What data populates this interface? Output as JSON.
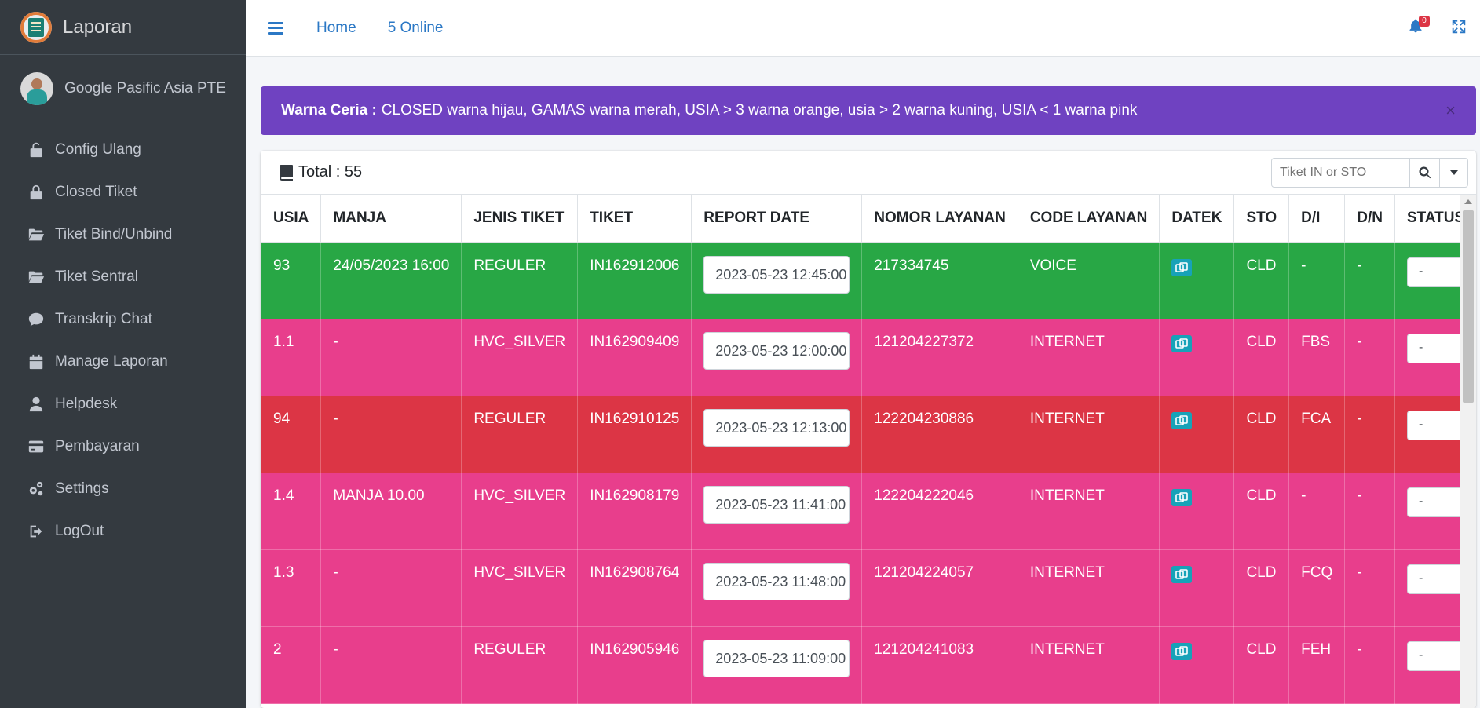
{
  "brand": {
    "title": "Laporan"
  },
  "user": {
    "name": "Google Pasific Asia PTE"
  },
  "sidebar": {
    "items": [
      {
        "label": "Config Ulang",
        "icon": "unlock-icon"
      },
      {
        "label": "Closed Tiket",
        "icon": "lock-icon"
      },
      {
        "label": "Tiket Bind/Unbind",
        "icon": "folder-open-icon"
      },
      {
        "label": "Tiket Sentral",
        "icon": "folder-open-icon"
      },
      {
        "label": "Transkrip Chat",
        "icon": "comment-icon"
      },
      {
        "label": "Manage Laporan",
        "icon": "calendar-icon"
      },
      {
        "label": "Helpdesk",
        "icon": "user-icon"
      },
      {
        "label": "Pembayaran",
        "icon": "credit-card-icon"
      },
      {
        "label": "Settings",
        "icon": "cogs-icon"
      },
      {
        "label": "LogOut",
        "icon": "sign-out-icon"
      }
    ]
  },
  "topbar": {
    "home": "Home",
    "online": "5 Online",
    "notif_count": "0"
  },
  "alert": {
    "title": "Warna Ceria :",
    "text": "CLOSED warna hijau, GAMAS warna merah, USIA > 3 warna orange, usia > 2 warna kuning, USIA < 1 warna pink",
    "close": "×"
  },
  "card": {
    "total": "Total : 55",
    "search_placeholder": "Tiket IN or STO"
  },
  "table": {
    "headers": [
      "USIA",
      "MANJA",
      "JENIS TIKET",
      "TIKET",
      "REPORT DATE",
      "NOMOR LAYANAN",
      "CODE LAYANAN",
      "DATEK",
      "STO",
      "D/I",
      "D/N",
      "STATUS TEKNISI"
    ],
    "rows": [
      {
        "color": "green",
        "usia": "93",
        "manja": "24/05/2023 16:00",
        "jenis": "REGULER",
        "tiket": "IN162912006",
        "report_date": "2023-05-23 12:45:00",
        "nomor": "217334745",
        "code": "VOICE",
        "sto": "CLD",
        "di": "-",
        "dn": "-",
        "status": "-"
      },
      {
        "color": "pink",
        "usia": "1.1",
        "manja": "-",
        "jenis": "HVC_SILVER",
        "tiket": "IN162909409",
        "report_date": "2023-05-23 12:00:00",
        "nomor": "121204227372",
        "code": "INTERNET",
        "sto": "CLD",
        "di": "FBS",
        "dn": "-",
        "status": "-"
      },
      {
        "color": "red",
        "usia": "94",
        "manja": "-",
        "jenis": "REGULER",
        "tiket": "IN162910125",
        "report_date": "2023-05-23 12:13:00",
        "nomor": "122204230886",
        "code": "INTERNET",
        "sto": "CLD",
        "di": "FCA",
        "dn": "-",
        "status": "-"
      },
      {
        "color": "pink",
        "usia": "1.4",
        "manja": "MANJA 10.00",
        "jenis": "HVC_SILVER",
        "tiket": "IN162908179",
        "report_date": "2023-05-23 11:41:00",
        "nomor": "122204222046",
        "code": "INTERNET",
        "sto": "CLD",
        "di": "-",
        "dn": "-",
        "status": "-"
      },
      {
        "color": "pink",
        "usia": "1.3",
        "manja": "-",
        "jenis": "HVC_SILVER",
        "tiket": "IN162908764",
        "report_date": "2023-05-23 11:48:00",
        "nomor": "121204224057",
        "code": "INTERNET",
        "sto": "CLD",
        "di": "FCQ",
        "dn": "-",
        "status": "-"
      },
      {
        "color": "pink",
        "usia": "2",
        "manja": "-",
        "jenis": "REGULER",
        "tiket": "IN162905946",
        "report_date": "2023-05-23 11:09:00",
        "nomor": "121204241083",
        "code": "INTERNET",
        "sto": "CLD",
        "di": "FEH",
        "dn": "-",
        "status": "-"
      }
    ]
  },
  "colors": {
    "green": "#28a745",
    "pink": "#e83e8c",
    "red": "#dc3545",
    "alert": "#6f42c1",
    "sidebar": "#343a40",
    "link": "#2b78c5"
  }
}
